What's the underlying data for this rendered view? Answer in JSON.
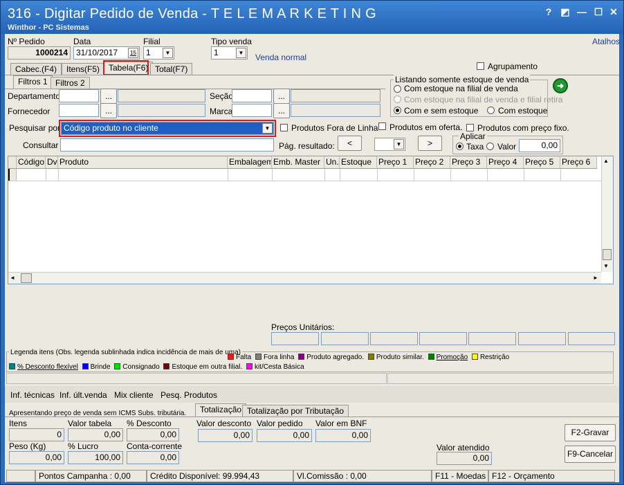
{
  "window": {
    "title": "316 - Digitar Pedido de Venda - T E L E M A R K E T I N G",
    "subtitle": "Winthor - PC Sistemas",
    "btn_help": "?",
    "btn_edit": "◩",
    "btn_min": "—",
    "btn_max": "☐",
    "btn_close": "✕"
  },
  "header": {
    "pedido_label": "Nº Pedido",
    "pedido_value": "1000214",
    "data_label": "Data",
    "data_value": "31/10/2017",
    "cal_glyph": "15",
    "filial_label": "Filial",
    "filial_value": "1",
    "tipo_venda_label": "Tipo venda",
    "tipo_venda_value": "1",
    "tipo_venda_desc": "Venda normal",
    "atalhos": "Atalhos",
    "agrupamento": "Agrupamento"
  },
  "tabs": [
    "Cabec.(F4)",
    "Itens(F5)",
    "Tabela(F6)",
    "Total(F7)"
  ],
  "subtabs": [
    "Filtros 1",
    "Filtros 2"
  ],
  "filters": {
    "departamento": "Departamento",
    "fornecedor": "Fornecedor",
    "secao": "Seção",
    "marca": "Marca",
    "ellipsis": "...",
    "estoque_group": "Listando somente estoque de venda",
    "estoque_opts": [
      "Com estoque na filial de venda",
      "Com estoque na filial de venda e filial retira",
      "Com e sem estoque",
      "Com estoque"
    ],
    "go_glyph": "➜"
  },
  "search": {
    "pesquisar_label": "Pesquisar por",
    "pesquisar_value": "Código produto no cliente",
    "fora_linha": "Produtos Fora de Linha",
    "oferta": "Produtos em oferta.",
    "preco_fixo": "Produtos com preço fixo.",
    "consultar_label": "Consultar",
    "pag_label": "Pág. resultado:",
    "prev": "<",
    "next": ">",
    "aplicar": "Aplicar",
    "taxa": "Taxa",
    "valor": "Valor",
    "valor_value": "0,00"
  },
  "grid": {
    "columns": [
      "Código",
      "Dv",
      "Produto",
      "Embalagem",
      "Emb. Master",
      "Un.",
      "Estoque",
      "Preço 1",
      "Preço 2",
      "Preço 3",
      "Preço 4",
      "Preço 5",
      "Preço 6"
    ],
    "up": "▲",
    "down": "▼",
    "left": "◄",
    "right": "►"
  },
  "precos_unitarios": "Preços Unitários:",
  "legend": {
    "title": "Legenda itens (Obs. legenda sublinhada indica incidência de mais de uma)",
    "row1": [
      {
        "label": "Falta",
        "color": "#e81c1c"
      },
      {
        "label": "Fora linha",
        "color": "#808080"
      },
      {
        "label": "Produto agregado.",
        "color": "#800080"
      },
      {
        "label": "Produto similar.",
        "color": "#808000"
      },
      {
        "label": "Promoção",
        "color": "#008000"
      },
      {
        "label": "Restrição",
        "color": "#ffff00"
      }
    ],
    "row2": [
      {
        "label": "% Desconto flexível",
        "color": "#008080"
      },
      {
        "label": "Brinde",
        "color": "#0000ff"
      },
      {
        "label": "Consignado",
        "color": "#00e000"
      },
      {
        "label": "Estoque em outra filial.",
        "color": "#800000"
      },
      {
        "label": "kit/Cesta Básica",
        "color": "#ff00ff"
      }
    ]
  },
  "links": [
    "Inf. técnicas",
    "Inf. últ.venda",
    "Mix cliente",
    "Pesq. Produtos"
  ],
  "totals": {
    "note": "Apresentando preço de venda sem ICMS Subs. tributária.",
    "tab1": "Totalização",
    "tab2": "Totalização por Tributação",
    "itens_label": "Itens",
    "itens_value": "0",
    "valor_tabela_label": "Valor tabela",
    "valor_tabela_value": "0,00",
    "desconto_label": "% Desconto",
    "desconto_value": "0,00",
    "peso_label": "Peso (Kg)",
    "peso_value": "0,00",
    "lucro_label": "% Lucro",
    "lucro_value": "100,00",
    "conta_label": "Conta-corrente",
    "conta_value": "0,00",
    "valor_desconto_label": "Valor desconto",
    "valor_desconto_value": "0,00",
    "valor_pedido_label": "Valor pedido",
    "valor_pedido_value": "0,00",
    "valor_bnf_label": "Valor em BNF",
    "valor_bnf_value": "0,00",
    "valor_atendido_label": "Valor atendido",
    "valor_atendido_value": "0,00",
    "gravar": "F2-Gravar",
    "cancelar": "F9-Cancelar"
  },
  "status": {
    "pontos": "Pontos Campanha : 0,00",
    "credito": "Crédito Disponível: 99.994,43",
    "comissao": "Vl.Comissão : 0,00",
    "moedas": "F11 - Moedas",
    "orcamento": "F12 - Orçamento"
  }
}
